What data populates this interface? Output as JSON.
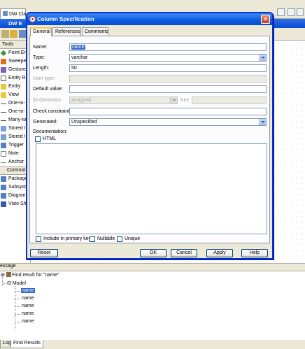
{
  "app": {
    "tabs": [
      {
        "label": "DW Cla"
      },
      {
        "label": "DW E"
      }
    ],
    "diagram_title": "DW E",
    "palette": {
      "header": "Tools",
      "items": [
        "Point Er",
        "Sweepe",
        "Gesture",
        "Entity Re",
        "Entity",
        "View",
        "One-to-",
        "One-to-",
        "Many-to",
        "Stored I",
        "Stored I",
        "Trigger",
        "Note",
        "Anchor"
      ],
      "subheader": "Common",
      "common_items": [
        "Package",
        "Subsyst",
        "Diagram",
        "Visio Sh"
      ]
    }
  },
  "dialog": {
    "title": "Column Specification",
    "close_glyph": "×",
    "tabs": [
      "General",
      "References",
      "Comments"
    ],
    "fields": {
      "name": {
        "label": "Name:",
        "value": "name"
      },
      "type": {
        "label": "Type:",
        "value": "varchar"
      },
      "length": {
        "label": "Length:",
        "value": "50"
      },
      "user_type": {
        "label": "User type:",
        "value": ""
      },
      "default_value": {
        "label": "Default value:",
        "value": ""
      },
      "id_generator": {
        "label": "ID Generator:",
        "value": "assigned"
      },
      "key": {
        "label": "Key:",
        "value": ""
      },
      "check_constraint": {
        "label": "Check constraint:",
        "value": ""
      },
      "generated": {
        "label": "Generated:",
        "value": "Unspecified"
      }
    },
    "documentation": {
      "label": "Documentation:",
      "html_label": "HTML"
    },
    "checkboxes": {
      "primary_key": "Include in primary key",
      "nullable": "Nullable",
      "unique": "Unique"
    },
    "buttons": {
      "reset": "Reset",
      "ok": "OK",
      "cancel": "Cancel",
      "apply": "Apply",
      "help": "Help"
    }
  },
  "messages": {
    "header": "essage",
    "find_result": "Find result for \"name\"",
    "model": "Model",
    "results": [
      "name",
      "name",
      "name",
      "name",
      "name"
    ],
    "tabs": [
      "Log",
      "Find Results"
    ]
  },
  "colors": {
    "dialog_border": "#0831d9",
    "title_blue": "#0a5ae0",
    "selection": "#316ac5",
    "xp_face": "#ece9d8"
  }
}
